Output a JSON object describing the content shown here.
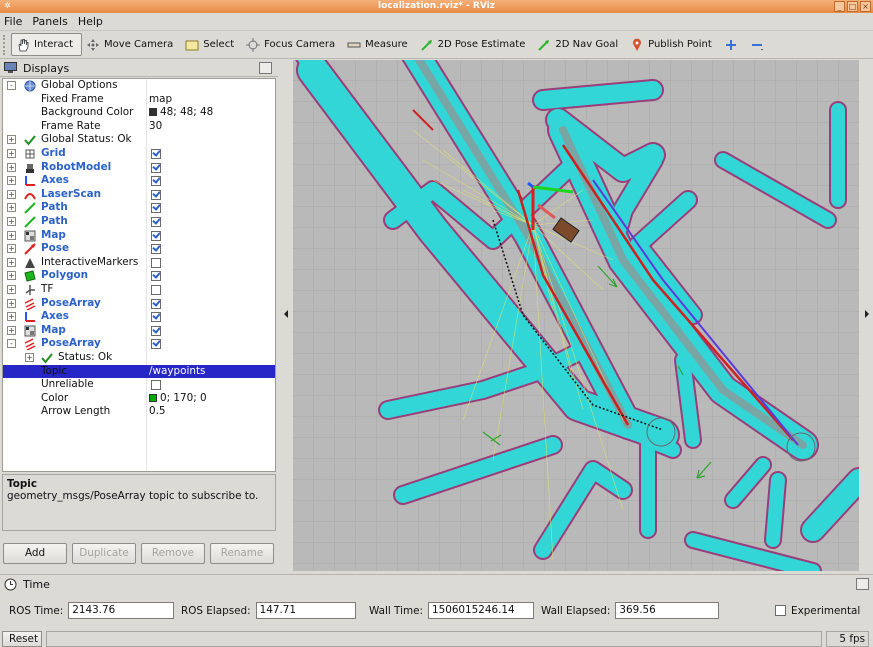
{
  "window": {
    "title": "localization.rviz* - RViz"
  },
  "menu": [
    "File",
    "Panels",
    "Help"
  ],
  "toolbar": {
    "tools": [
      {
        "label": "Interact",
        "icon": "hand-icon",
        "active": true
      },
      {
        "label": "Move Camera",
        "icon": "move-camera-icon"
      },
      {
        "label": "Select",
        "icon": "select-icon"
      },
      {
        "label": "Focus Camera",
        "icon": "focus-camera-icon"
      },
      {
        "label": "Measure",
        "icon": "measure-icon"
      },
      {
        "label": "2D Pose Estimate",
        "icon": "pose-estimate-arrow-icon"
      },
      {
        "label": "2D Nav Goal",
        "icon": "nav-goal-arrow-icon"
      },
      {
        "label": "Publish Point",
        "icon": "map-pin-icon"
      }
    ]
  },
  "displays": {
    "title": "Displays",
    "rows": [
      {
        "name": "Global Options",
        "depth": 0,
        "exp": "-",
        "icon": "globe-icon"
      },
      {
        "name": "Fixed Frame",
        "depth": 1,
        "value": "map"
      },
      {
        "name": "Background Color",
        "depth": 1,
        "value": "48; 48; 48",
        "swatch": "#303030"
      },
      {
        "name": "Frame Rate",
        "depth": 1,
        "value": "30"
      },
      {
        "name": "Global Status: Ok",
        "depth": 0,
        "exp": "+",
        "icon": "check-icon"
      },
      {
        "name": "Grid",
        "depth": 0,
        "exp": "+",
        "icon": "grid-icon",
        "blue": true,
        "check": true
      },
      {
        "name": "RobotModel",
        "depth": 0,
        "exp": "+",
        "icon": "robot-icon",
        "blue": true,
        "check": true
      },
      {
        "name": "Axes",
        "depth": 0,
        "exp": "+",
        "icon": "axes-icon",
        "blue": true,
        "check": true
      },
      {
        "name": "LaserScan",
        "depth": 0,
        "exp": "+",
        "icon": "laserscan-icon",
        "blue": true,
        "check": true
      },
      {
        "name": "Path",
        "depth": 0,
        "exp": "+",
        "icon": "path-icon",
        "blue": true,
        "check": true
      },
      {
        "name": "Path",
        "depth": 0,
        "exp": "+",
        "icon": "path-icon",
        "blue": true,
        "check": true
      },
      {
        "name": "Map",
        "depth": 0,
        "exp": "+",
        "icon": "map-icon",
        "blue": true,
        "check": true
      },
      {
        "name": "Pose",
        "depth": 0,
        "exp": "+",
        "icon": "pose-icon",
        "blue": true,
        "check": true
      },
      {
        "name": "InteractiveMarkers",
        "depth": 0,
        "exp": "+",
        "icon": "interactive-markers-icon",
        "check": false
      },
      {
        "name": "Polygon",
        "depth": 0,
        "exp": "+",
        "icon": "polygon-icon",
        "blue": true,
        "check": true
      },
      {
        "name": "TF",
        "depth": 0,
        "exp": "+",
        "icon": "tf-icon",
        "check": false
      },
      {
        "name": "PoseArray",
        "depth": 0,
        "exp": "+",
        "icon": "posearray-icon",
        "blue": true,
        "check": true
      },
      {
        "name": "Axes",
        "depth": 0,
        "exp": "+",
        "icon": "axes-icon",
        "blue": true,
        "check": true
      },
      {
        "name": "Map",
        "depth": 0,
        "exp": "+",
        "icon": "map-icon",
        "blue": true,
        "check": true
      },
      {
        "name": "PoseArray",
        "depth": 0,
        "exp": "-",
        "icon": "posearray-icon",
        "blue": true,
        "check": true
      },
      {
        "name": "Status: Ok",
        "depth": 1,
        "exp": "+",
        "icon": "check-icon"
      },
      {
        "name": "Topic",
        "depth": 1,
        "value": "/waypoints",
        "selected": true
      },
      {
        "name": "Unreliable",
        "depth": 1,
        "check": false
      },
      {
        "name": "Color",
        "depth": 1,
        "value": "0; 170; 0",
        "swatch": "#00aa00"
      },
      {
        "name": "Arrow Length",
        "depth": 1,
        "value": "0.5"
      }
    ]
  },
  "description": {
    "title": "Topic",
    "text": "geometry_msgs/PoseArray topic to subscribe to."
  },
  "panel_buttons": [
    {
      "label": "Add",
      "enabled": true
    },
    {
      "label": "Duplicate",
      "enabled": false
    },
    {
      "label": "Remove",
      "enabled": false
    },
    {
      "label": "Rename",
      "enabled": false
    }
  ],
  "time": {
    "title": "Time",
    "ros_time_label": "ROS Time:",
    "ros_time": "2143.76",
    "ros_elapsed_label": "ROS Elapsed:",
    "ros_elapsed": "147.71",
    "wall_time_label": "Wall Time:",
    "wall_time": "1506015246.14",
    "wall_elapsed_label": "Wall Elapsed:",
    "wall_elapsed": "369.56",
    "experimental_label": "Experimental"
  },
  "status": {
    "reset_label": "Reset",
    "fps": "5 fps"
  },
  "colors": {
    "costmap": "#33d6d6",
    "obstacle": "#9a3d7a",
    "grid": "#b7b7b7",
    "title_bar": "#e98a44",
    "selection": "#2727c7"
  }
}
